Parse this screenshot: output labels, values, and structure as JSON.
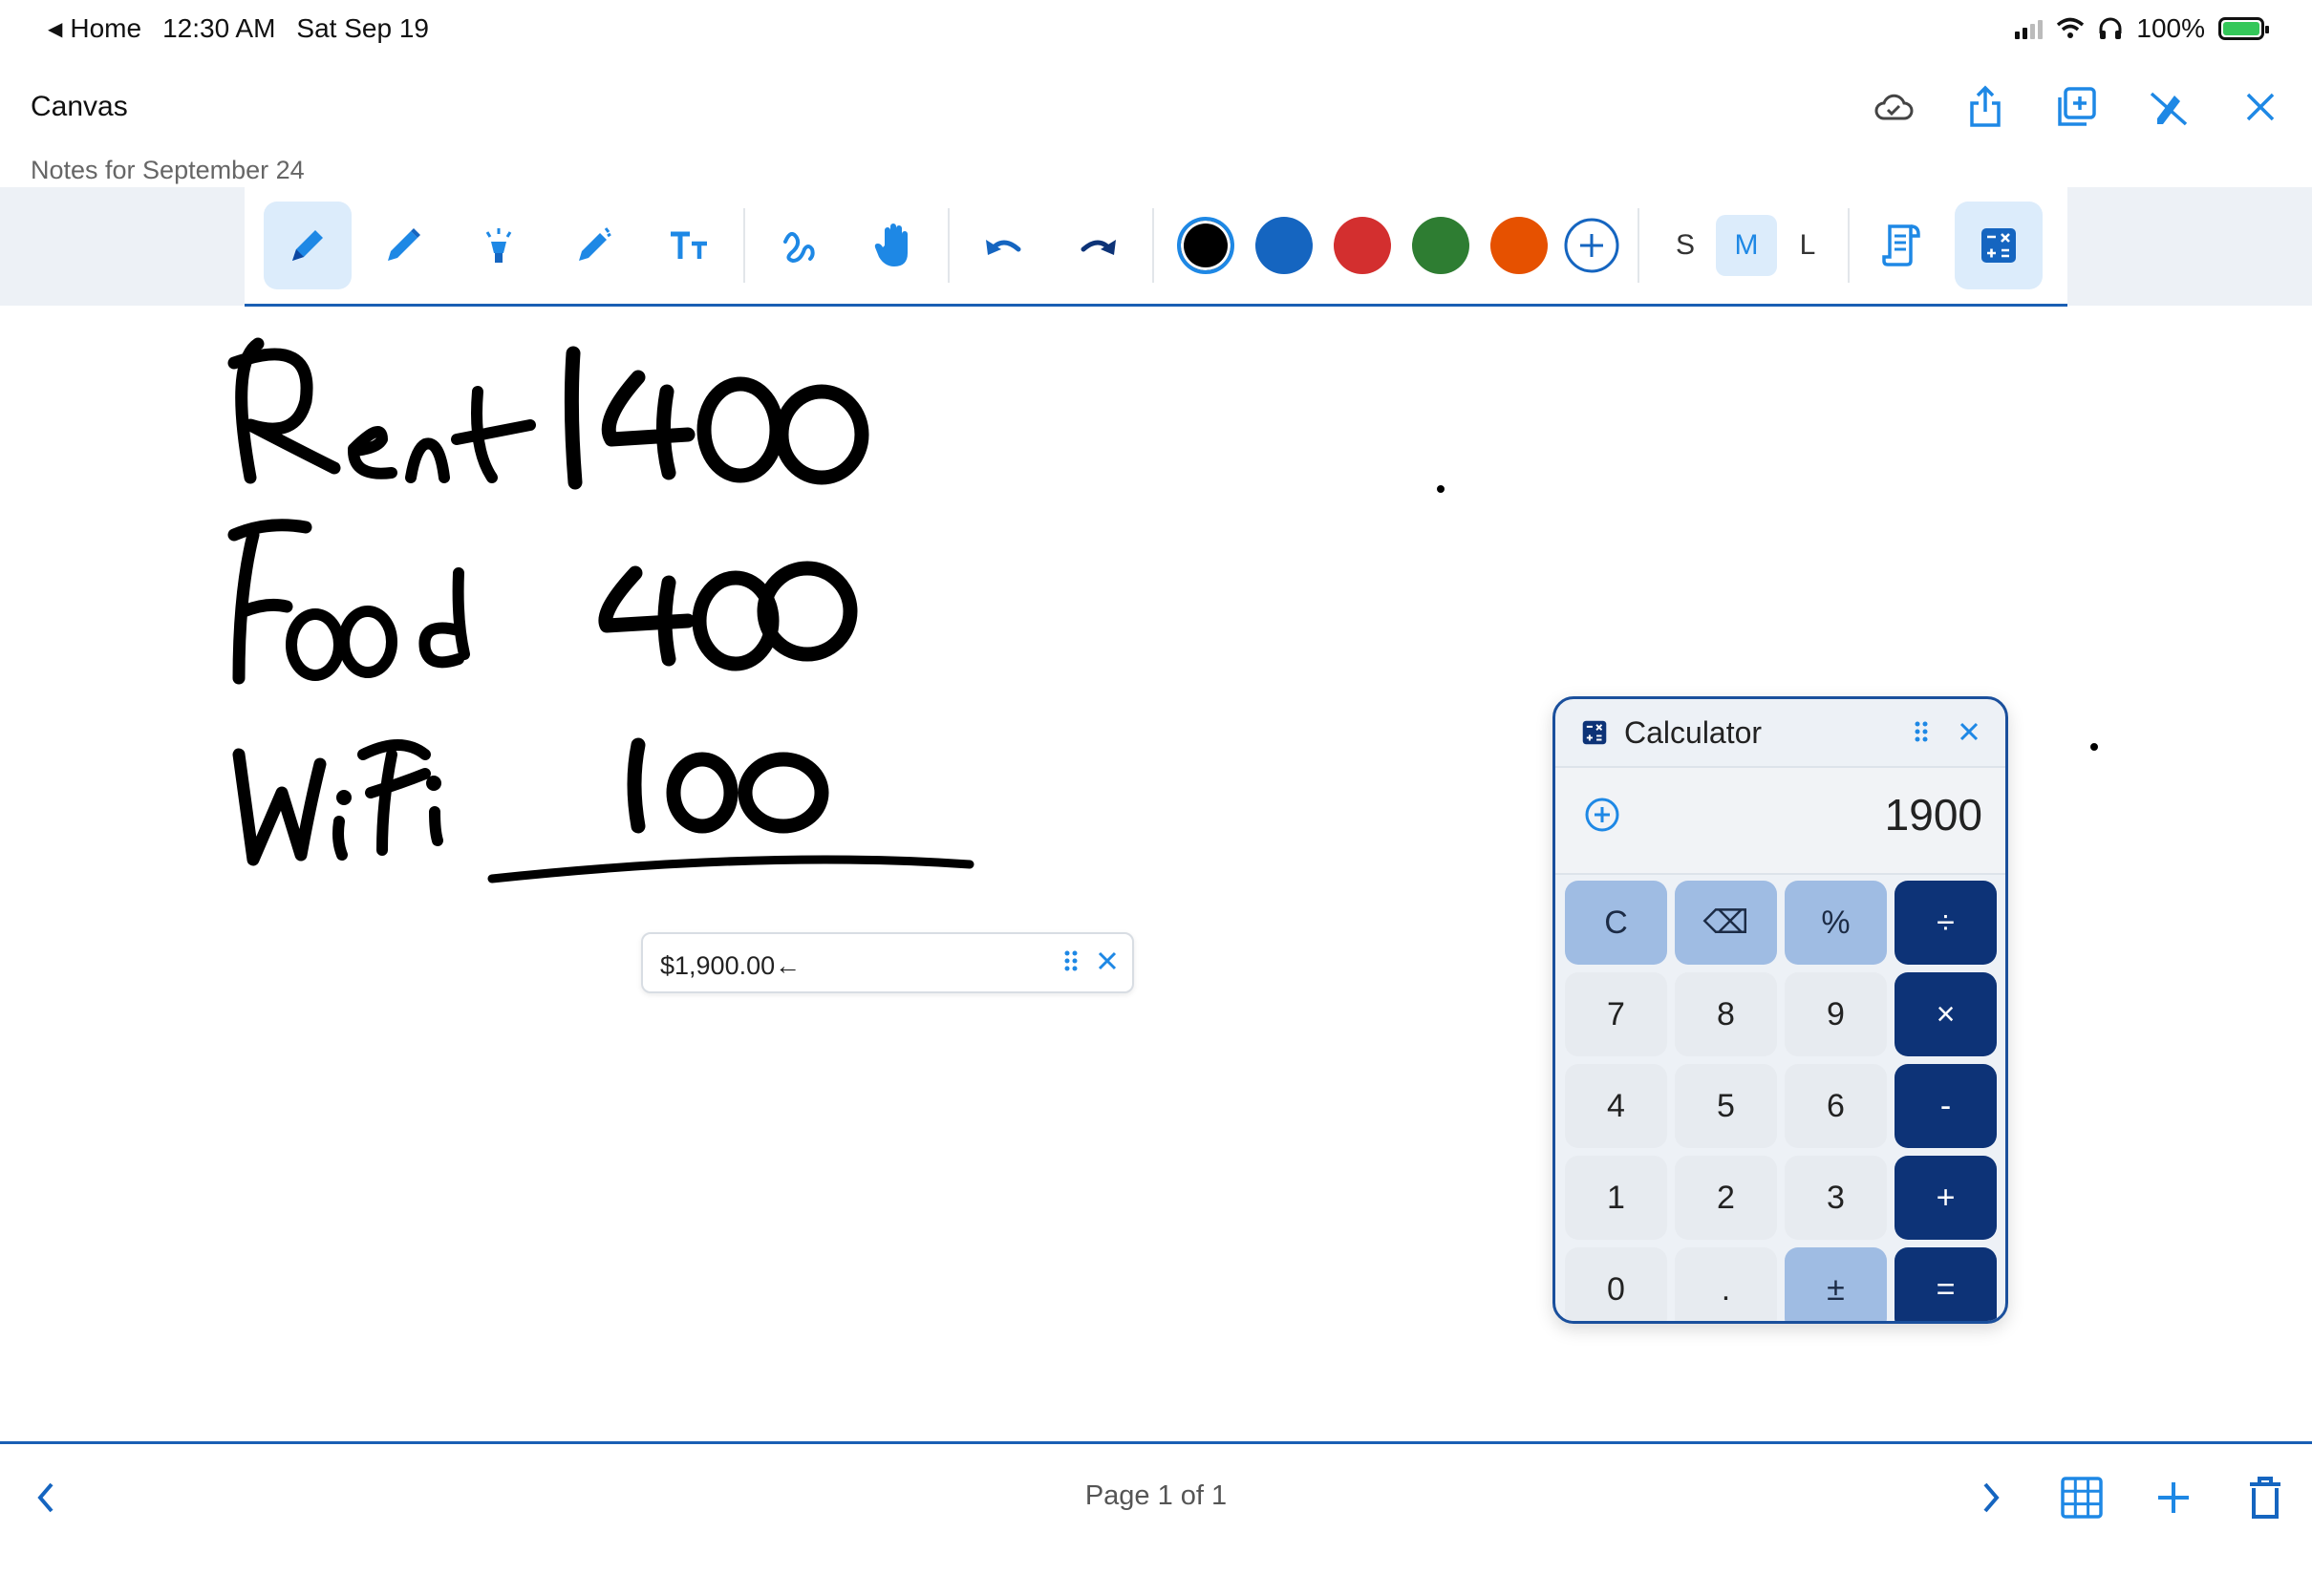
{
  "status_bar": {
    "back_label": "Home",
    "time": "12:30 AM",
    "date": "Sat Sep 19",
    "battery": "100%"
  },
  "header": {
    "title": "Canvas",
    "subtitle": "Notes for September 24",
    "icons": [
      "cloud-check-icon",
      "share-icon",
      "add-page-icon",
      "pen-off-icon",
      "close-icon"
    ]
  },
  "toolbar": {
    "tools": [
      "pen-icon",
      "pencil-icon",
      "highlighter-icon",
      "marker-icon",
      "text-icon",
      "lasso-icon",
      "hand-icon",
      "undo-icon",
      "redo-icon"
    ],
    "colors": [
      "#000000",
      "#1565c0",
      "#d32f2f",
      "#2e7d32",
      "#e65100"
    ],
    "sizes": [
      "S",
      "M",
      "L"
    ],
    "selected_size": "M",
    "accent": "#1e88e5"
  },
  "result_chip": {
    "value": "$1,900.00←"
  },
  "calculator": {
    "title": "Calculator",
    "display": "1900",
    "keys": [
      [
        "C",
        "l"
      ],
      [
        "⌫",
        "l"
      ],
      [
        "%",
        "l"
      ],
      [
        "÷",
        "d"
      ],
      [
        "7",
        "n"
      ],
      [
        "8",
        "n"
      ],
      [
        "9",
        "n"
      ],
      [
        "×",
        "d"
      ],
      [
        "4",
        "n"
      ],
      [
        "5",
        "n"
      ],
      [
        "6",
        "n"
      ],
      [
        "-",
        "d"
      ],
      [
        "1",
        "n"
      ],
      [
        "2",
        "n"
      ],
      [
        "3",
        "n"
      ],
      [
        "+",
        "d"
      ],
      [
        "0",
        "n"
      ],
      [
        ".",
        "n"
      ],
      [
        "±",
        "l"
      ],
      [
        "=",
        "d"
      ]
    ]
  },
  "footer": {
    "page_label": "Page 1 of 1",
    "icons": [
      "chevron-left-icon",
      "chevron-right-icon",
      "grid-icon",
      "plus-icon",
      "trash-icon"
    ]
  }
}
